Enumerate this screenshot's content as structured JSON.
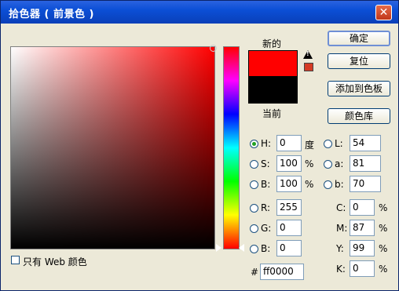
{
  "title": "拾色器 ( 前景色 )",
  "close_glyph": "✕",
  "colors": {
    "new": "#ff0000",
    "current": "#000000",
    "gamut_warning": "#d53b25"
  },
  "labels": {
    "new": "新的",
    "current": "当前"
  },
  "buttons": {
    "ok": "确定",
    "reset": "复位",
    "add_to_swatches": "添加到色板",
    "color_libraries": "颜色库"
  },
  "hsb": {
    "h": {
      "label": "H:",
      "value": "0",
      "unit": "度"
    },
    "s": {
      "label": "S:",
      "value": "100",
      "unit": "%"
    },
    "b": {
      "label": "B:",
      "value": "100",
      "unit": "%"
    }
  },
  "rgb": {
    "r": {
      "label": "R:",
      "value": "255"
    },
    "g": {
      "label": "G:",
      "value": "0"
    },
    "b": {
      "label": "B:",
      "value": "0"
    }
  },
  "lab": {
    "l": {
      "label": "L:",
      "value": "54"
    },
    "a": {
      "label": "a:",
      "value": "81"
    },
    "b": {
      "label": "b:",
      "value": "70"
    }
  },
  "cmyk": {
    "c": {
      "label": "C:",
      "value": "0",
      "unit": "%"
    },
    "m": {
      "label": "M:",
      "value": "87",
      "unit": "%"
    },
    "y": {
      "label": "Y:",
      "value": "99",
      "unit": "%"
    },
    "k": {
      "label": "K:",
      "value": "0",
      "unit": "%"
    }
  },
  "hex": {
    "label": "#",
    "value": "ff0000"
  },
  "web_only": {
    "label": "只有 Web 颜色",
    "checked": false
  },
  "selected_mode": "H"
}
